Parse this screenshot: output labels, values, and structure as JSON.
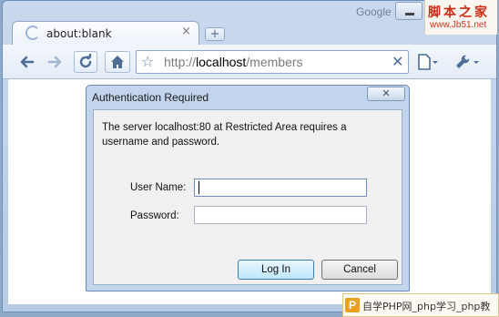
{
  "browser": {
    "google_label": "Google",
    "tab": {
      "title": "about:blank",
      "close": "×"
    },
    "new_tab": "+",
    "url": {
      "scheme": "http://",
      "host": "localhost",
      "path": "/members"
    },
    "icons": {
      "back": "back-arrow-icon",
      "forward": "forward-arrow-icon",
      "reload": "reload-icon",
      "home": "home-icon",
      "star": "star-icon",
      "stop": "stop-icon",
      "page_menu": "page-menu-icon",
      "tools_menu": "wrench-icon"
    }
  },
  "watermark": {
    "top_chars": "脚本之家",
    "top_url": "www.Jb51.net",
    "bottom_text": "自学PHP网_php学习_php教"
  },
  "dialog": {
    "title": "Authentication Required",
    "close": "✕",
    "message": "The server localhost:80 at Restricted Area requires a username and password.",
    "username_label": "User Name:",
    "username_value": "",
    "password_label": "Password:",
    "password_value": "",
    "login_label": "Log In",
    "cancel_label": "Cancel"
  },
  "colors": {
    "frame": "#b7cbe6",
    "dialog_frame": "#c3d5ec",
    "dialog_body": "#f0f0f0",
    "default_button": "#bee6fd"
  }
}
